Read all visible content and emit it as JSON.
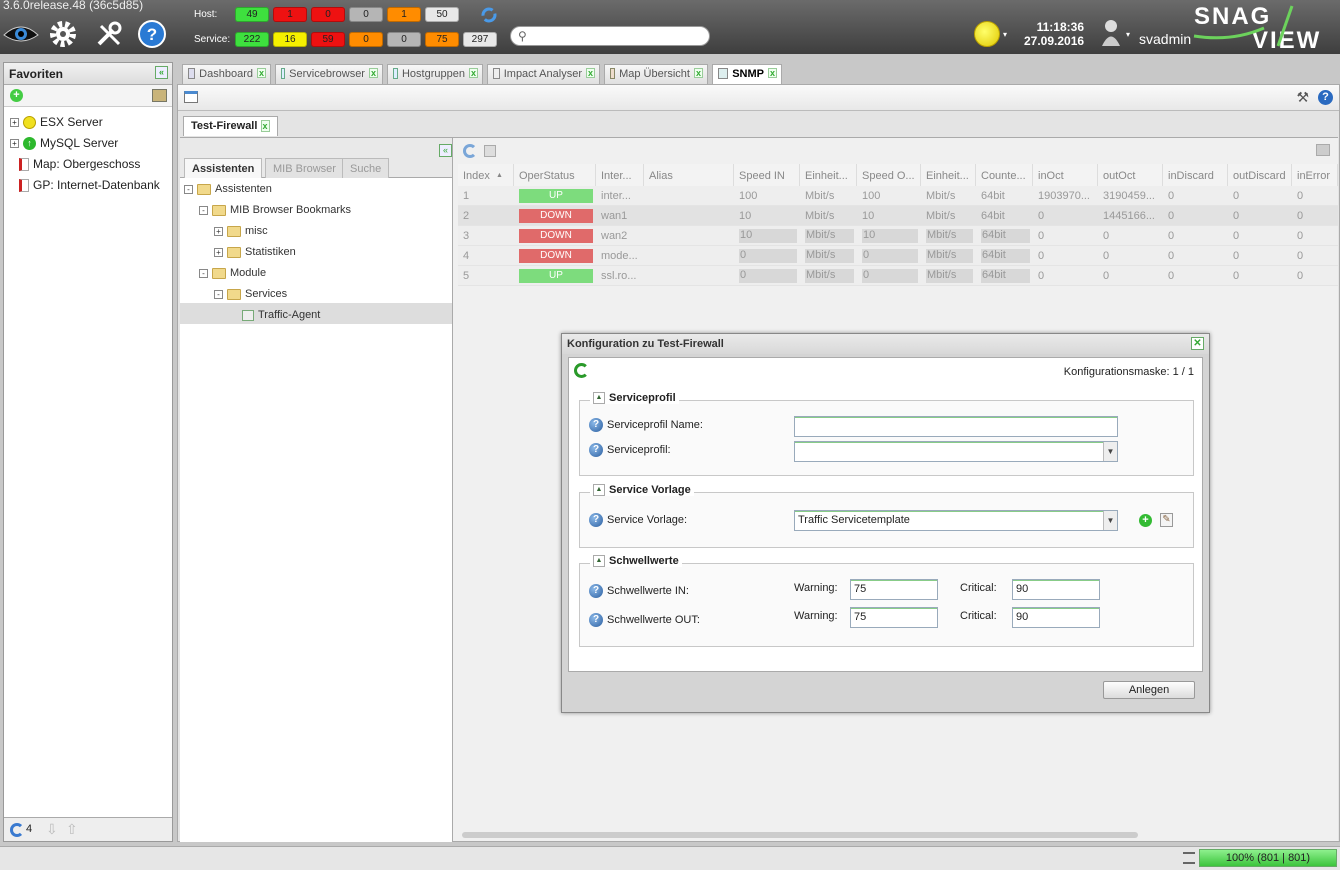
{
  "app": {
    "version": "3.6.0release.48 (36c5d85)",
    "logo": "SNAG VIEW"
  },
  "header": {
    "host_label": "Host:",
    "service_label": "Service:",
    "host_counts": [
      "49",
      "1",
      "0",
      "0",
      "1",
      "50"
    ],
    "service_counts": [
      "222",
      "16",
      "59",
      "0",
      "0",
      "75",
      "297"
    ],
    "host_colors": [
      "#3ee03e",
      "#ee1111",
      "#ee1111",
      "#b5b5b5",
      "#ff8c00",
      "#e8e8e8"
    ],
    "service_colors": [
      "#3ee03e",
      "#f5f000",
      "#ee1111",
      "#ff8c00",
      "#b5b5b5",
      "#ff8c00",
      "#e8e8e8"
    ],
    "search_placeholder": "",
    "time": "11:18:36",
    "date": "27.09.2016",
    "user": "svadmin"
  },
  "favorites": {
    "title": "Favoriten",
    "items": [
      {
        "label": "ESX Server",
        "icon": "yellow-status-icon"
      },
      {
        "label": "MySQL Server",
        "icon": "green-status-icon"
      },
      {
        "label": "Map: Obergeschoss",
        "icon": "map-icon"
      },
      {
        "label": "GP: Internet-Datenbank",
        "icon": "map-icon"
      }
    ],
    "footer_count": "4"
  },
  "tabs": [
    "Dashboard",
    "Servicebrowser",
    "Hostgruppen",
    "Impact Analyser",
    "Map Übersicht",
    "SNMP"
  ],
  "subtab": "Test-Firewall",
  "tree": {
    "tabs": [
      "Assistenten",
      "MIB Browser",
      "Suche"
    ],
    "nodes": [
      "Assistenten",
      "MIB Browser Bookmarks",
      "misc",
      "Statistiken",
      "Module",
      "Services",
      "Traffic-Agent"
    ]
  },
  "table": {
    "headers": [
      "Index",
      "OperStatus",
      "Inter...",
      "Alias",
      "Speed IN",
      "Einheit...",
      "Speed O...",
      "Einheit...",
      "Counte...",
      "inOct",
      "outOct",
      "inDiscard",
      "outDiscard",
      "inError"
    ],
    "rows": [
      [
        "1",
        "UP",
        "inter...",
        "",
        "100",
        "Mbit/s",
        "100",
        "Mbit/s",
        "64bit",
        "1903970...",
        "3190459...",
        "0",
        "0",
        "0"
      ],
      [
        "2",
        "DOWN",
        "wan1",
        "",
        "10",
        "Mbit/s",
        "10",
        "Mbit/s",
        "64bit",
        "0",
        "1445166...",
        "0",
        "0",
        "0"
      ],
      [
        "3",
        "DOWN",
        "wan2",
        "",
        "10",
        "Mbit/s",
        "10",
        "Mbit/s",
        "64bit",
        "0",
        "0",
        "0",
        "0",
        "0"
      ],
      [
        "4",
        "DOWN",
        "mode...",
        "",
        "0",
        "Mbit/s",
        "0",
        "Mbit/s",
        "64bit",
        "0",
        "0",
        "0",
        "0",
        "0"
      ],
      [
        "5",
        "UP",
        "ssl.ro...",
        "",
        "0",
        "Mbit/s",
        "0",
        "Mbit/s",
        "64bit",
        "0",
        "0",
        "0",
        "0",
        "0"
      ]
    ]
  },
  "dialog": {
    "title": "Konfiguration zu Test-Firewall",
    "mask": "Konfigurationsmaske: 1 / 1",
    "serviceprofil": {
      "title": "Serviceprofil",
      "name_label": "Serviceprofil Name:",
      "profile_label": "Serviceprofil:",
      "name_value": "",
      "profile_value": ""
    },
    "vorlage": {
      "title": "Service Vorlage",
      "label": "Service Vorlage:",
      "value": "Traffic Servicetemplate"
    },
    "schwellwerte": {
      "title": "Schwellwerte",
      "in_label": "Schwellwerte IN:",
      "out_label": "Schwellwerte OUT:",
      "warning_label": "Warning:",
      "critical_label": "Critical:",
      "in_warning": "75",
      "in_critical": "90",
      "out_warning": "75",
      "out_critical": "90"
    },
    "submit": "Anlegen"
  },
  "status": {
    "progress": "100% (801 | 801)"
  }
}
